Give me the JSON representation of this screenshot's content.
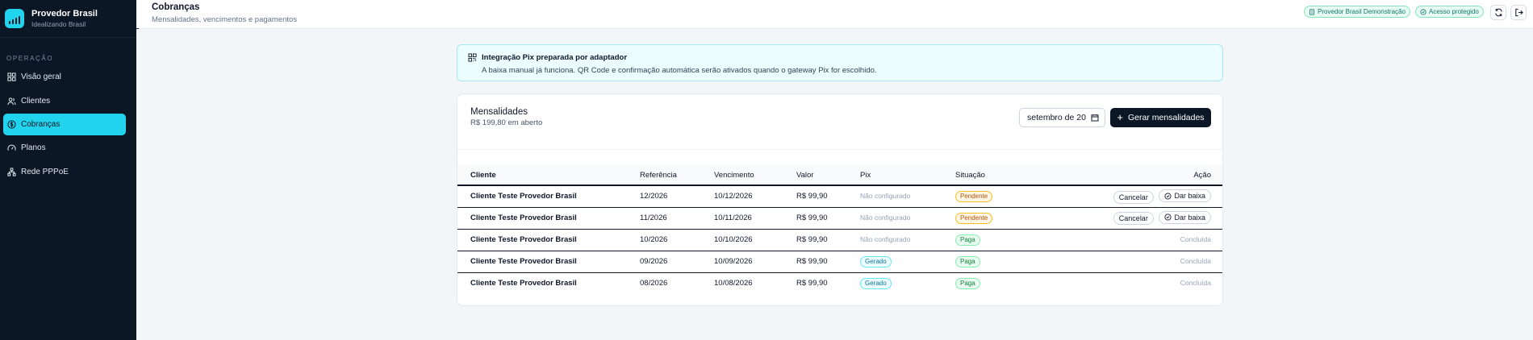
{
  "brand": {
    "title": "Provedor Brasil",
    "subtitle": "Idealizando Brasil"
  },
  "sidebar": {
    "section_label": "OPERAÇÃO",
    "items": [
      {
        "label": "Visão geral",
        "icon": "dashboard-icon",
        "active": false
      },
      {
        "label": "Clientes",
        "icon": "users-icon",
        "active": false
      },
      {
        "label": "Cobranças",
        "icon": "dollar-circle-icon",
        "active": true
      },
      {
        "label": "Planos",
        "icon": "gauge-icon",
        "active": false
      },
      {
        "label": "Rede PPPoE",
        "icon": "network-icon",
        "active": false
      }
    ]
  },
  "header": {
    "title": "Cobranças",
    "subtitle": "Mensalidades, vencimentos e pagamentos",
    "tenant_badge": "Provedor Brasil Demonstração",
    "access_badge": "Acesso protegido"
  },
  "banner": {
    "title": "Integração Pix preparada por adaptador",
    "text": "A baixa manual já funciona. QR Code e confirmação automática serão ativados quando o gateway Pix for escolhido."
  },
  "card": {
    "title": "Mensalidades",
    "subtitle": "R$ 199,80 em aberto",
    "month_value": "setembro de 20",
    "generate_label": "Gerar mensalidades"
  },
  "table": {
    "headers": {
      "cliente": "Cliente",
      "referencia": "Referência",
      "vencimento": "Vencimento",
      "valor": "Valor",
      "pix": "Pix",
      "situacao": "Situação",
      "acao": "Ação"
    },
    "rows": [
      {
        "cliente": "Cliente Teste Provedor Brasil",
        "referencia": "12/2026",
        "vencimento": "10/12/2026",
        "valor": "R$ 99,90",
        "pix": "Não configurado",
        "pix_kind": "none",
        "situacao": "Pendente",
        "status_kind": "pending",
        "cancel": "Cancelar",
        "settle": "Dar baixa"
      },
      {
        "cliente": "Cliente Teste Provedor Brasil",
        "referencia": "11/2026",
        "vencimento": "10/11/2026",
        "valor": "R$ 99,90",
        "pix": "Não configurado",
        "pix_kind": "none",
        "situacao": "Pendente",
        "status_kind": "pending",
        "cancel": "Cancelar",
        "settle": "Dar baixa"
      },
      {
        "cliente": "Cliente Teste Provedor Brasil",
        "referencia": "10/2026",
        "vencimento": "10/10/2026",
        "valor": "R$ 99,90",
        "pix": "Não configurado",
        "pix_kind": "none",
        "situacao": "Paga",
        "status_kind": "paid",
        "done": "Concluída"
      },
      {
        "cliente": "Cliente Teste Provedor Brasil",
        "referencia": "09/2026",
        "vencimento": "10/09/2026",
        "valor": "R$ 99,90",
        "pix": "Gerado",
        "pix_kind": "gerado",
        "situacao": "Paga",
        "status_kind": "paid",
        "done": "Concluída"
      },
      {
        "cliente": "Cliente Teste Provedor Brasil",
        "referencia": "08/2026",
        "vencimento": "10/08/2026",
        "valor": "R$ 99,90",
        "pix": "Gerado",
        "pix_kind": "gerado",
        "situacao": "Paga",
        "status_kind": "paid",
        "done": "Concluída"
      }
    ]
  },
  "colors": {
    "accent": "#22d3ee",
    "sidebar_bg": "#0b1725",
    "background": "#f3f6f9"
  }
}
